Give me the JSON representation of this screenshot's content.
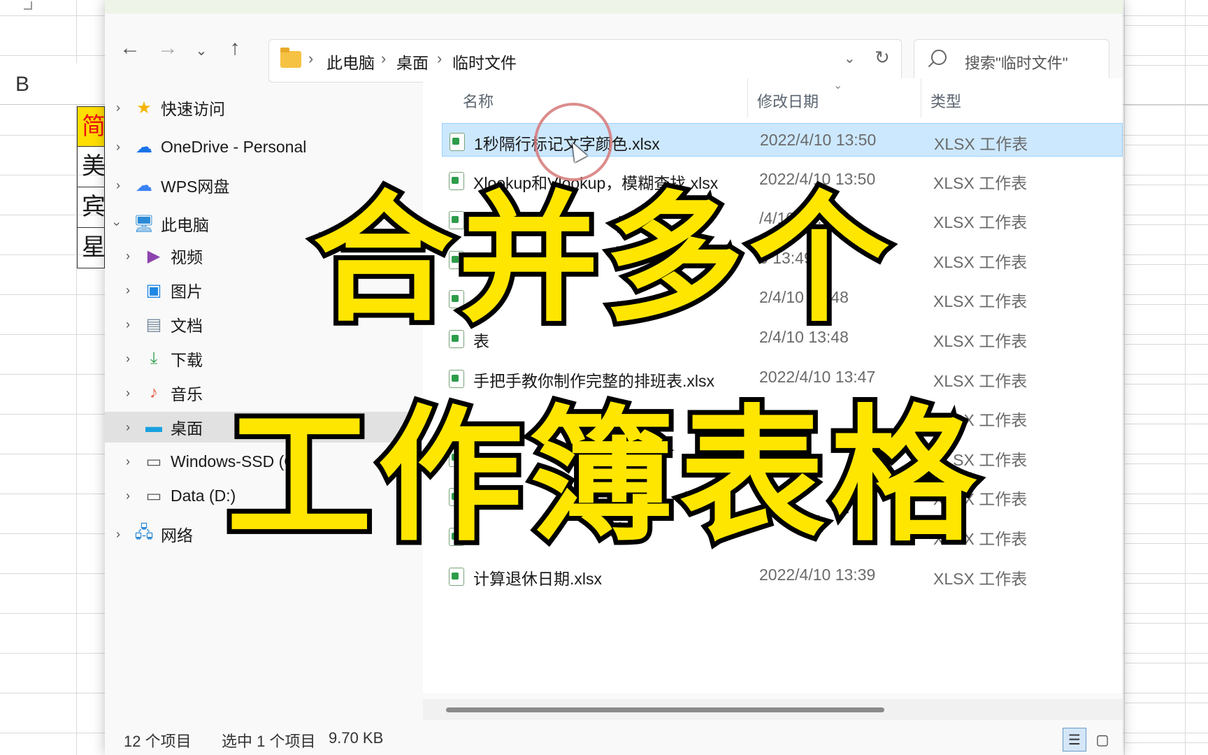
{
  "sheet": {
    "column_letter": "B",
    "cells": [
      "简",
      "美",
      "宾",
      "星"
    ]
  },
  "address_bar": {
    "crumbs": [
      "此电脑",
      "桌面",
      "临时文件"
    ]
  },
  "search": {
    "placeholder": "搜索\"临时文件\""
  },
  "nav": {
    "items": [
      {
        "label": "快速访问",
        "icon": "star-icon"
      },
      {
        "label": "OneDrive - Personal",
        "icon": "cloud-icon"
      },
      {
        "label": "WPS网盘",
        "icon": "wps-cloud-icon"
      },
      {
        "label": "此电脑",
        "icon": "computer-icon"
      },
      {
        "label": "视频",
        "icon": "video-icon"
      },
      {
        "label": "图片",
        "icon": "picture-icon"
      },
      {
        "label": "文档",
        "icon": "document-icon"
      },
      {
        "label": "下载",
        "icon": "download-icon"
      },
      {
        "label": "音乐",
        "icon": "music-icon"
      },
      {
        "label": "桌面",
        "icon": "desktop-icon"
      },
      {
        "label": "Windows-SSD (C:)",
        "icon": "drive-c-icon"
      },
      {
        "label": "Data (D:)",
        "icon": "drive-d-icon"
      },
      {
        "label": "网络",
        "icon": "network-icon"
      }
    ]
  },
  "columns": {
    "name": "名称",
    "date": "修改日期",
    "type": "类型"
  },
  "files": [
    {
      "name": "1秒隔行标记文字颜色.xlsx",
      "date": "2022/4/10 13:50",
      "type": "XLSX 工作表"
    },
    {
      "name": "Xlookup和Vlookup，模糊查找.xlsx",
      "date": "2022/4/10 13:50",
      "type": "XLSX 工作表"
    },
    {
      "name": "计",
      "date": "/4/10 13:49",
      "type": "XLSX 工作表"
    },
    {
      "name": "",
      "date": "0 13:49",
      "type": "XLSX 工作表"
    },
    {
      "name": "",
      "date": "2/4/10 13:48",
      "type": "XLSX 工作表"
    },
    {
      "name": "表",
      "date": "2/4/10 13:48",
      "type": "XLSX 工作表"
    },
    {
      "name": "手把手教你制作完整的排班表.xlsx",
      "date": "2022/4/10 13:47",
      "type": "XLSX 工作表"
    },
    {
      "name": "",
      "date": "",
      "type": "XLSX 工作表"
    },
    {
      "name": "",
      "date": "",
      "type": "XLSX 工作表"
    },
    {
      "name": "",
      "date": "",
      "type": "XLSX 工作表"
    },
    {
      "name": "",
      "date": "",
      "type": "XLSX 工作表"
    },
    {
      "name": "计算退休日期.xlsx",
      "date": "2022/4/10 13:39",
      "type": "XLSX 工作表"
    }
  ],
  "status": {
    "count": "12 个项目",
    "selected": "选中 1 个项目",
    "size": "9.70 KB"
  },
  "overlay": {
    "line1": "合并多个",
    "line2": "工作簿表格"
  },
  "colors": {
    "overlay_text": "#ffe600",
    "selection": "#cce8ff"
  }
}
